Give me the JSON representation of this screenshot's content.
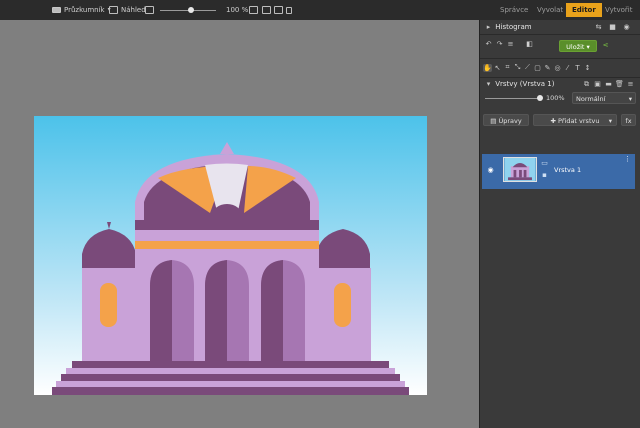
{
  "toolbar": {
    "browser_label": "Průzkumník",
    "preview_label": "Náhled",
    "zoom_value": "100 %",
    "zoom_fraction": 0.55
  },
  "modules": {
    "tabs": [
      "Správce",
      "Vyvolat",
      "Editor",
      "Vytvořit"
    ],
    "active": "Editor"
  },
  "panel": {
    "histogram_title": "Histogram",
    "save_label": "Uložit",
    "layers_title": "Vrstvy (Vrstva 1)",
    "opacity_value": "100%",
    "opacity_fraction": 1.0,
    "blend_mode": "Normální",
    "adjust_label": "Úpravy",
    "add_layer_label": "Přidat vrstvu",
    "fx_label": "fx",
    "layer_name": "Vrstva 1"
  },
  "colors": {
    "accent": "#e9a21b",
    "save_green": "#5a8f2a",
    "selected_layer": "#3b6aa8"
  }
}
